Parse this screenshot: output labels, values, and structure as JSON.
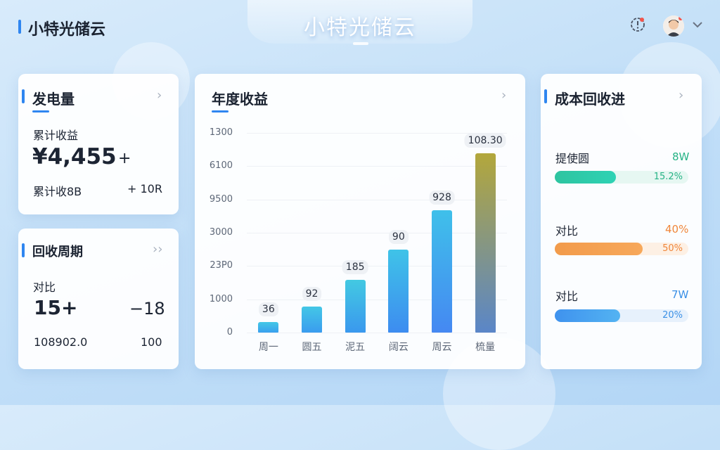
{
  "app": {
    "name": "小特光储云",
    "center_title": "小特光储云"
  },
  "header": {
    "alert_icon": "alert-clock-icon",
    "avatar_icon": "user-avatar",
    "dropdown_icon": "chevron-down-icon"
  },
  "power_card": {
    "title": "发电量",
    "cum_label": "累计收益",
    "cum_value": "¥4,455",
    "cum_suffix": "+",
    "row_label": "累计收8B",
    "row_value": "+ 10R"
  },
  "cycle_card": {
    "title": "回收周期",
    "compare_label": "对比",
    "left_value": "15+",
    "right_value": "−18",
    "row_left": "108902.0",
    "row_right": "100"
  },
  "income_card": {
    "title": "年度收益",
    "y_ticks": [
      "1300",
      "6100",
      "9500",
      "3000",
      "23P0",
      "1000",
      "0"
    ]
  },
  "chart_data": {
    "type": "bar",
    "title": "年度收益",
    "categories": [
      "周一",
      "圆五",
      "泥五",
      "阔云",
      "周云",
      "梳量"
    ],
    "values": [
      36,
      92,
      185,
      290,
      428,
      628
    ],
    "data_labels": [
      "36",
      "92",
      "185",
      "90",
      "928",
      "108.30"
    ],
    "ylim": [
      0,
      700
    ],
    "grid": true
  },
  "cost_card": {
    "title": "成本回收进",
    "items": [
      {
        "label": "提使圆",
        "value": "8W",
        "pct_text": "15.2%",
        "progress": 0.46,
        "value_color": "#27b386",
        "pct_color": "#27b386"
      },
      {
        "label": "对比",
        "value": "40%",
        "pct_text": "50%",
        "progress": 0.66,
        "value_color": "#f0863a",
        "pct_color": "#f0863a"
      },
      {
        "label": "对比",
        "value": "7W",
        "pct_text": "20%",
        "progress": 0.49,
        "value_color": "#3b90e6",
        "pct_color": "#3b90e6"
      }
    ]
  },
  "colors": {
    "accent": "#2f86f0",
    "green_start": "#2ec4a0",
    "green_end": "#2ed2b4",
    "orange_start": "#f29b4b",
    "orange_end": "#f7a85a",
    "blue_start": "#3f92ee",
    "blue_end": "#53b3f2"
  }
}
